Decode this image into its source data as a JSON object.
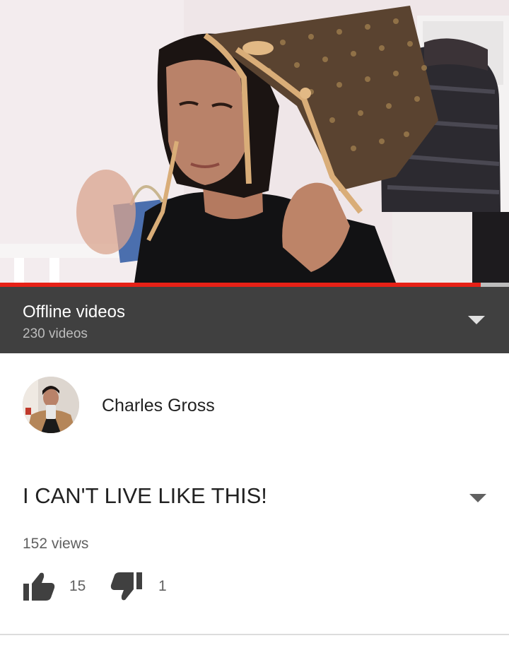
{
  "player": {
    "progress_fraction": 0.945
  },
  "playlist": {
    "title": "Offline videos",
    "count": "230 videos",
    "toggle_icon": "chevron-down-icon"
  },
  "channel": {
    "name": "Charles Gross",
    "avatar_icon": "avatar"
  },
  "video": {
    "title": "I CAN'T LIVE LIKE THIS!",
    "views": "152 views",
    "likes": "15",
    "dislikes": "1"
  },
  "colors": {
    "progress": "#e62117",
    "bar_background": "#404040",
    "text_primary": "#212121",
    "text_secondary": "#616161"
  }
}
